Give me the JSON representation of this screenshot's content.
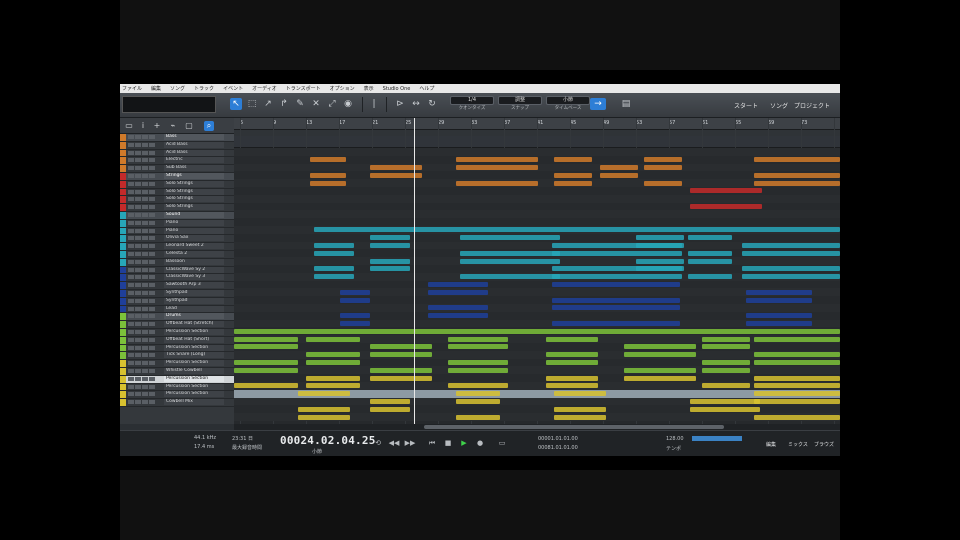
{
  "menu": [
    "ファイル",
    "編集",
    "ソング",
    "トラック",
    "イベント",
    "オーディオ",
    "トランスポート",
    "オプション",
    "表示",
    "Studio One",
    "ヘルプ"
  ],
  "toolbar": {
    "groups": [
      {
        "value": "1/4",
        "label": "クオンタイズ"
      },
      {
        "value": "調整",
        "label": "スナップ"
      },
      {
        "value": "小節",
        "label": "タイムベース"
      }
    ],
    "links": [
      "スタート",
      "ソング",
      "プロジェクト"
    ]
  },
  "ruler": [
    "5",
    "9",
    "13",
    "17",
    "21",
    "25",
    "29",
    "33",
    "37",
    "41",
    "45",
    "49",
    "53",
    "57",
    "61",
    "65",
    "69",
    "73"
  ],
  "tracks": [
    {
      "name": "Bass",
      "color": "#d07a2a",
      "folder": true
    },
    {
      "name": "Acid Bass",
      "color": "#d07a2a"
    },
    {
      "name": "Acid Bass",
      "color": "#d07a2a"
    },
    {
      "name": "Electric",
      "color": "#d07a2a"
    },
    {
      "name": "Sub Bass",
      "color": "#d07a2a"
    },
    {
      "name": "Strings",
      "color": "#c42a2a",
      "folder": true
    },
    {
      "name": "Solo Strings",
      "color": "#c42a2a"
    },
    {
      "name": "Solo Strings",
      "color": "#c42a2a"
    },
    {
      "name": "Solo Strings",
      "color": "#c42a2a"
    },
    {
      "name": "Solo Strings",
      "color": "#c42a2a"
    },
    {
      "name": "Sound",
      "color": "#27a6b8",
      "folder": true
    },
    {
      "name": "Piano",
      "color": "#27a6b8"
    },
    {
      "name": "Piano",
      "color": "#27a6b8"
    },
    {
      "name": "Olivia Sax",
      "color": "#27a6b8"
    },
    {
      "name": "Leonard Sweet 2",
      "color": "#27a6b8"
    },
    {
      "name": "Celesta 2",
      "color": "#27a6b8"
    },
    {
      "name": "Bassoon",
      "color": "#27a6b8"
    },
    {
      "name": "ClassicWave Sy 2",
      "color": "#1f3f9a"
    },
    {
      "name": "ClassicWave Sy 3",
      "color": "#1f3f9a"
    },
    {
      "name": "Sawtooth Arp 3",
      "color": "#1f3f9a"
    },
    {
      "name": "Synthpad",
      "color": "#1f3f9a"
    },
    {
      "name": "Synthpad",
      "color": "#1f3f9a"
    },
    {
      "name": "Lead",
      "color": "#1f3f9a"
    },
    {
      "name": "Drums",
      "color": "#7cc23a",
      "folder": true
    },
    {
      "name": "Offbeat Hat (Stretch)",
      "color": "#7cc23a"
    },
    {
      "name": "Percussion Section",
      "color": "#7cc23a"
    },
    {
      "name": "Offbeat Hat (Short)",
      "color": "#7cc23a"
    },
    {
      "name": "Percussion Section",
      "color": "#7cc23a"
    },
    {
      "name": "Tick Snare (Long)",
      "color": "#7cc23a"
    },
    {
      "name": "Percussion Section",
      "color": "#d8c230"
    },
    {
      "name": "Whistle Cowbell",
      "color": "#d8c230"
    },
    {
      "name": "Percussion Section",
      "color": "#d8c230",
      "selected": true
    },
    {
      "name": "Percussion Section",
      "color": "#d8c230"
    },
    {
      "name": "Percussion Section",
      "color": "#d8c230"
    },
    {
      "name": "Cowbell Mix",
      "color": "#d8c230"
    }
  ],
  "transport": {
    "sample_rate": "44.1 kHz",
    "latency": "17.4 ms",
    "record_time": "23:31 日",
    "record_label": "最大録音時間",
    "position": "00024.02.04.25",
    "position_unit": "小節",
    "loop_start": "00001.01.01.00",
    "loop_end": "00081.01.01.00",
    "tempo": "128.00",
    "metronome_label": "テンポ",
    "links": [
      "編集",
      "ミックス",
      "ブラウズ"
    ]
  }
}
